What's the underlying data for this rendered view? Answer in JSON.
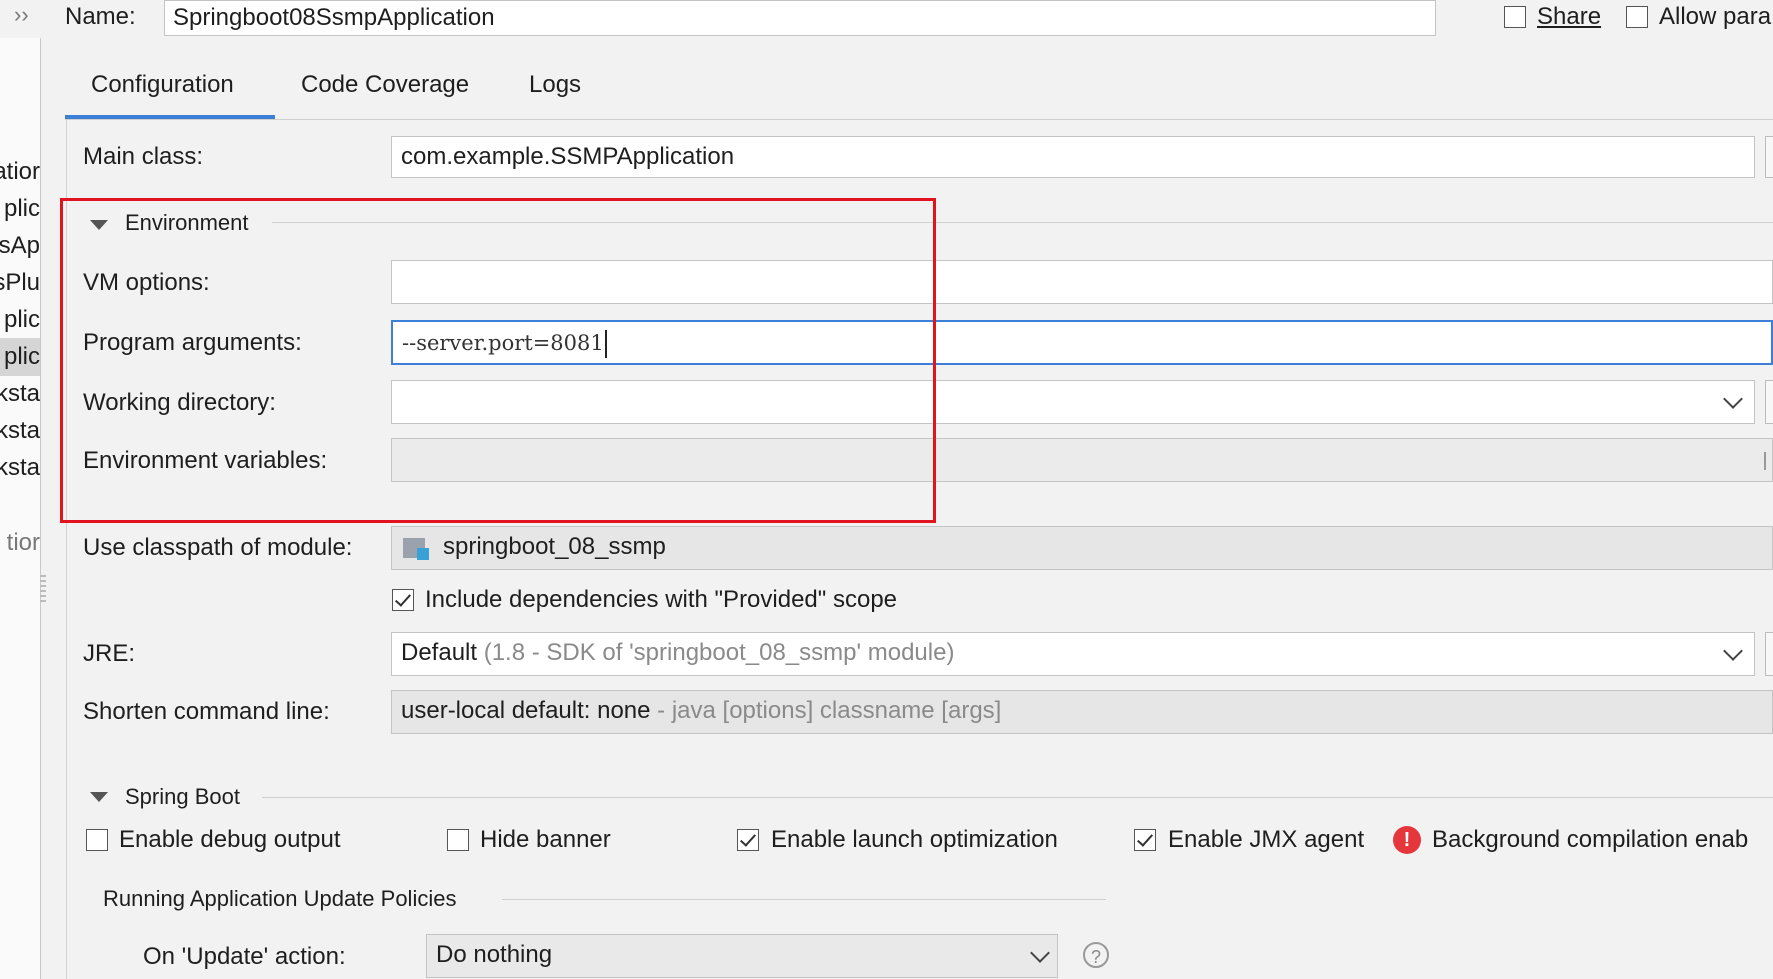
{
  "header": {
    "name_label": "Name:",
    "name_value": "Springboot08SsmpApplication",
    "share_label": "Share",
    "share_checked": false,
    "allow_label": "Allow para",
    "allow_checked": false
  },
  "left_tree": [
    "atior",
    "plic",
    "sAp",
    "sPlu",
    "plic",
    "plic",
    "ksta",
    "ksta",
    "ksta",
    "tior"
  ],
  "tabs": [
    {
      "label": "Configuration",
      "active": true
    },
    {
      "label": "Code Coverage",
      "active": false
    },
    {
      "label": "Logs",
      "active": false
    }
  ],
  "main_class": {
    "label": "Main class:",
    "value": "com.example.SSMPApplication"
  },
  "environment": {
    "title": "Environment",
    "vm_options_label": "VM options:",
    "vm_options_value": "",
    "program_args_label": "Program arguments:",
    "program_args_value": "--server.port=8081",
    "working_dir_label": "Working directory:",
    "working_dir_value": "",
    "env_vars_label": "Environment variables:",
    "env_vars_value": ""
  },
  "classpath": {
    "label": "Use classpath of module:",
    "module": "springboot_08_ssmp"
  },
  "include_deps": {
    "label": "Include dependencies with \"Provided\" scope",
    "checked": true
  },
  "jre": {
    "label": "JRE:",
    "value": "Default",
    "hint": "(1.8 - SDK of 'springboot_08_ssmp' module)"
  },
  "shorten": {
    "label": "Shorten command line:",
    "value": "user-local default: none",
    "hint": "- java [options] classname [args]"
  },
  "spring_boot": {
    "title": "Spring Boot",
    "debug_output": {
      "label": "Enable debug output",
      "checked": false
    },
    "hide_banner": {
      "label": "Hide banner",
      "checked": false
    },
    "launch_opt": {
      "label": "Enable launch optimization",
      "checked": true
    },
    "jmx_agent": {
      "label": "Enable JMX agent",
      "checked": true
    },
    "bg_compilation": "Background compilation enab"
  },
  "update_policies": {
    "title": "Running Application Update Policies",
    "on_update_label": "On 'Update' action:",
    "on_update_value": "Do nothing"
  },
  "colors": {
    "accent": "#3d7fd6",
    "highlight_box": "#e0141e",
    "error": "#e5363c"
  }
}
